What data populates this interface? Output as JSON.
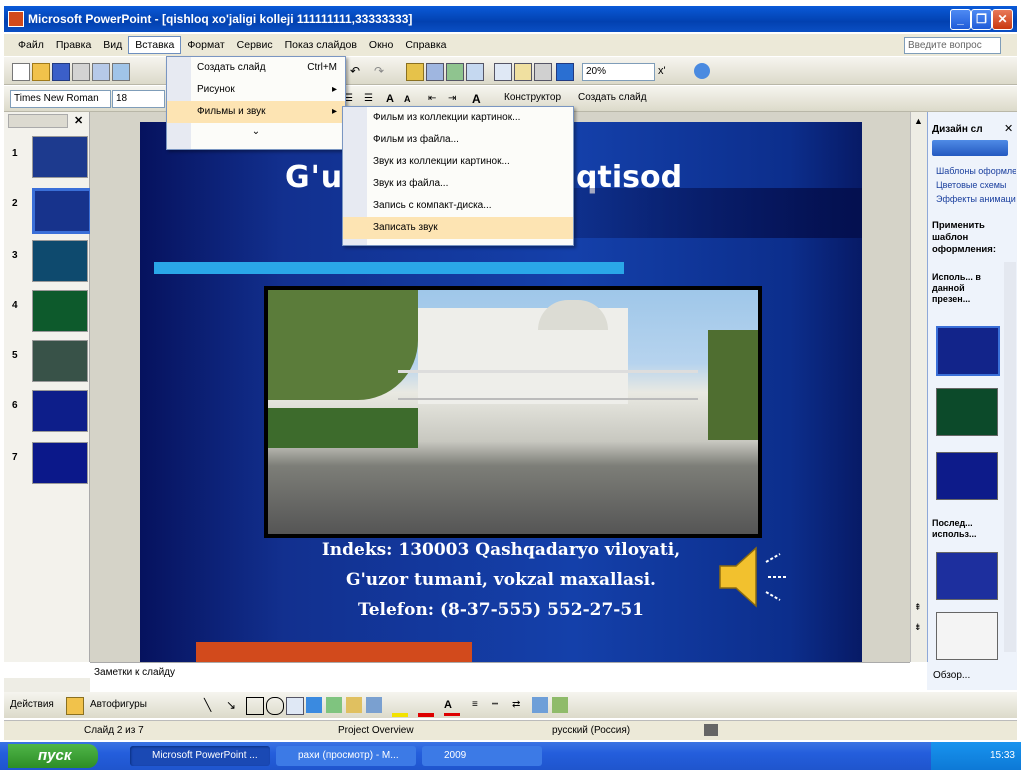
{
  "window": {
    "title": "Microsoft PowerPoint - [qishloq xo'jaligi kolleji 111111111,33333333]"
  },
  "menubar": {
    "items": [
      "Файл",
      "Правка",
      "Вид",
      "Вставка",
      "Формат",
      "Сервис",
      "Показ слайдов",
      "Окно",
      "Справка"
    ],
    "ask_placeholder": "Введите вопрос"
  },
  "toolbar": {
    "font_name": "Times New Roman",
    "font_size": "18",
    "zoom": "20%",
    "constructor_label": "Конструктор",
    "create_slide_label": "Создать слайд"
  },
  "insert_menu": {
    "items": [
      {
        "label": "Создать слайд",
        "shortcut": "Ctrl+M"
      },
      {
        "label": "Рисунок",
        "submenu": true
      },
      {
        "label": "Фильмы и звук",
        "submenu": true
      }
    ]
  },
  "sound_submenu": {
    "items": [
      "Фильм из коллекции картинок...",
      "Фильм из файла...",
      "Звук из коллекции картинок...",
      "Звук из файла...",
      "Запись с компакт-диска...",
      "Записать звук"
    ]
  },
  "slides_pane": {
    "numbers": [
      "1",
      "2",
      "3",
      "4",
      "5",
      "6",
      "7"
    ]
  },
  "slide": {
    "title_left": "G'u",
    "title_right": "qtisod",
    "line1": "Indeks: 130003 Qashqadaryo viloyati,",
    "line2": "G'uzor tumani, vokzal maxallasi.",
    "line3": "Telefon: (8-37-555) 552-27-51"
  },
  "taskpane": {
    "title": "Дизайн сл",
    "link1": "Шаблоны оформления",
    "link2": "Цветовые схемы",
    "link3": "Эффекты анимации",
    "apply_label": "Применить шаблон оформления:",
    "section1": "Исполь... в данной презен...",
    "section2": "Послед... использ...",
    "browse": "Обзор..."
  },
  "notes": {
    "placeholder": "Заметки к слайду"
  },
  "drawing_toolbar": {
    "actions_label": "Действия",
    "autoshapes_label": "Автофигуры"
  },
  "statusbar": {
    "slide_info": "Слайд 2 из 7",
    "design": "Project Overview",
    "language": "русский (Россия)"
  },
  "taskbar": {
    "start_label": "пуск",
    "items": [
      "Microsoft PowerPoint ...",
      "рахи (просмотр) - М...",
      "2009"
    ],
    "clock": "15:33"
  }
}
